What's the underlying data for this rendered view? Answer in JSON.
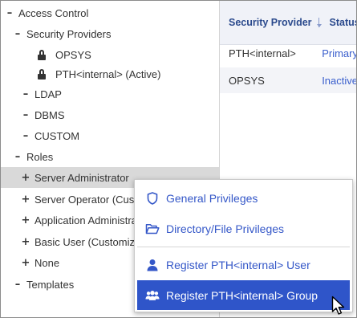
{
  "tree": {
    "access_control": "Access Control",
    "security_providers": "Security Providers",
    "opsys": "OPSYS",
    "pth_internal": "PTH<internal> (Active)",
    "ldap": "LDAP",
    "dbms": "DBMS",
    "custom": "CUSTOM",
    "roles": "Roles",
    "server_administrator": "Server Administrator",
    "server_operator": "Server Operator (Customized)",
    "application_administrator": "Application Administrator",
    "basic_user": "Basic User (Customized)",
    "none": "None",
    "templates": "Templates"
  },
  "table": {
    "headers": {
      "provider": "Security Provider",
      "status": "Status"
    },
    "rows": [
      {
        "provider": "PTH<internal>",
        "status": "Primary"
      },
      {
        "provider": "OPSYS",
        "status": "Inactive"
      }
    ]
  },
  "context_menu": {
    "general_privileges": "General Privileges",
    "directory_file_privileges": "Directory/File Privileges",
    "register_user": "Register PTH<internal> User",
    "register_group": "Register PTH<internal> Group"
  },
  "colors": {
    "accent": "#2f55c9",
    "link": "#3457c8",
    "header_text": "#2b4a8d",
    "selected_row": "#d9d9d9"
  },
  "icons": {
    "expanded": "minus",
    "collapsed": "plus",
    "provider": "lock-icon",
    "general_privileges": "shield-icon",
    "directory_file_privileges": "folder-open-icon",
    "register_user": "user-icon",
    "register_group": "group-icon"
  }
}
